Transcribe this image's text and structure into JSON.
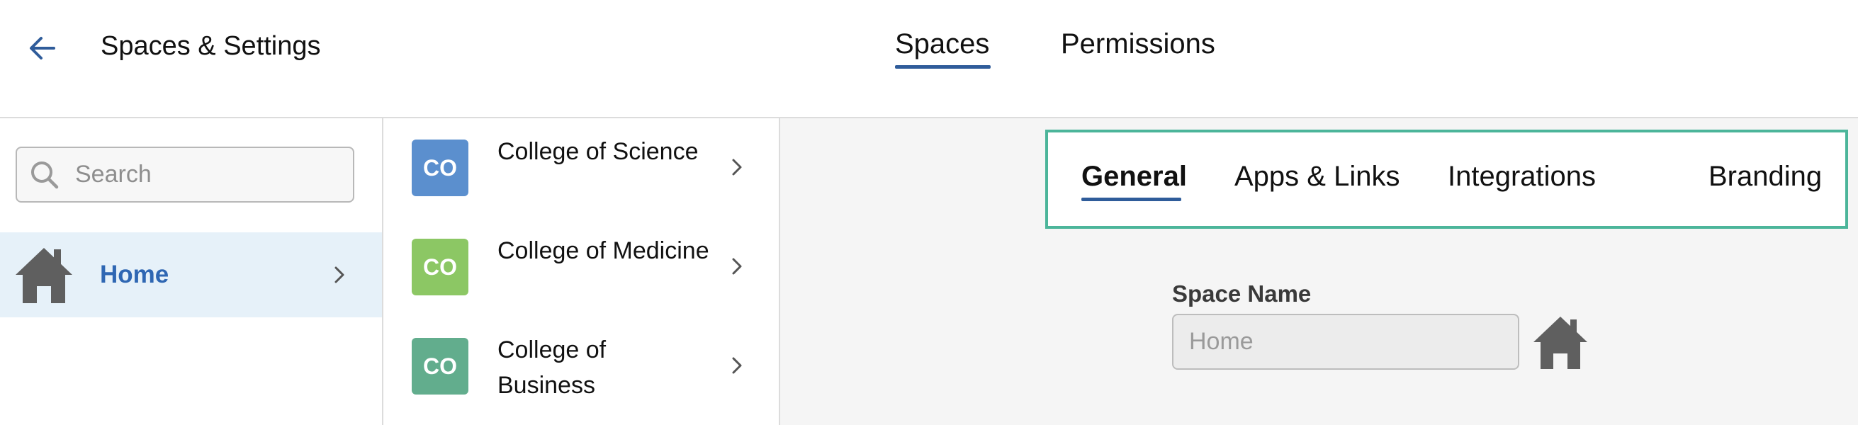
{
  "header": {
    "back_icon": "arrow-left-icon",
    "title": "Spaces & Settings",
    "tabs": [
      {
        "label": "Spaces",
        "active": true
      },
      {
        "label": "Permissions",
        "active": false
      }
    ]
  },
  "sidebar": {
    "search": {
      "placeholder": "Search",
      "value": "",
      "icon": "search-icon"
    },
    "items": [
      {
        "label": "Home",
        "icon": "house-icon",
        "selected": true
      }
    ]
  },
  "colleges": [
    {
      "badge": "CO",
      "name": "College of Science",
      "color": "#5b8fce"
    },
    {
      "badge": "CO",
      "name": "College of Medicine",
      "color": "#8cc764"
    },
    {
      "badge": "CO",
      "name": "College of Business",
      "color": "#62ad8d"
    }
  ],
  "settings": {
    "tabs": [
      {
        "label": "General",
        "active": true
      },
      {
        "label": "Apps & Links",
        "active": false
      },
      {
        "label": "Integrations",
        "active": false
      },
      {
        "label": "Branding",
        "active": false
      }
    ],
    "space_name": {
      "label": "Space Name",
      "placeholder": "Home",
      "value": "",
      "icon": "house-icon"
    }
  },
  "colors": {
    "accent": "#2f5c9a",
    "selected_bg": "#e6f1f9",
    "selected_text": "#2f67b3",
    "highlight_border": "#4cb59a",
    "icon_gray": "#5f5f5f"
  }
}
